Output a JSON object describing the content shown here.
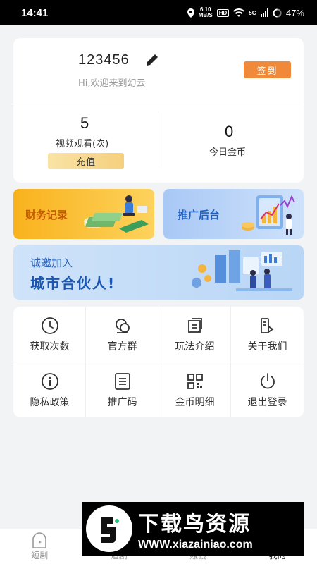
{
  "status_bar": {
    "time": "14:41",
    "net_speed": "6.10",
    "net_unit": "MB/S",
    "hd": "HD",
    "network": "5G",
    "battery": "47%"
  },
  "profile": {
    "username": "123456",
    "welcome": "Hi,欢迎来到幻云",
    "signin_label": "签到"
  },
  "stats": {
    "views_value": "5",
    "views_label": "视频观看(次)",
    "recharge_label": "充值",
    "coins_value": "0",
    "coins_label": "今日金币"
  },
  "banners": {
    "finance": "财务记录",
    "promo": "推广后台",
    "partner_line1": "诚邀加入",
    "partner_line2": "城市合伙人!"
  },
  "menu": [
    {
      "label": "获取次数",
      "icon": "clock-icon"
    },
    {
      "label": "官方群",
      "icon": "group-chat-icon"
    },
    {
      "label": "玩法介绍",
      "icon": "guide-icon"
    },
    {
      "label": "关于我们",
      "icon": "about-icon"
    },
    {
      "label": "隐私政策",
      "icon": "info-icon"
    },
    {
      "label": "推广码",
      "icon": "document-icon"
    },
    {
      "label": "金币明细",
      "icon": "qr-grid-icon"
    },
    {
      "label": "退出登录",
      "icon": "power-icon"
    }
  ],
  "bottom_nav": {
    "items": [
      "短剧",
      "追剧",
      "赚钱",
      "我的"
    ]
  },
  "watermark": {
    "title": "下载鸟资源",
    "url": "WWW.xiazainiao.com"
  },
  "colors": {
    "accent": "#f08a3a",
    "recharge": "#f5d07e",
    "finance_banner": "#f9b21d",
    "promo_banner": "#a8c8f5",
    "partner_banner": "#cfe3f9",
    "banner_text_orange": "#c45a00",
    "banner_text_blue": "#1f5fbf"
  }
}
